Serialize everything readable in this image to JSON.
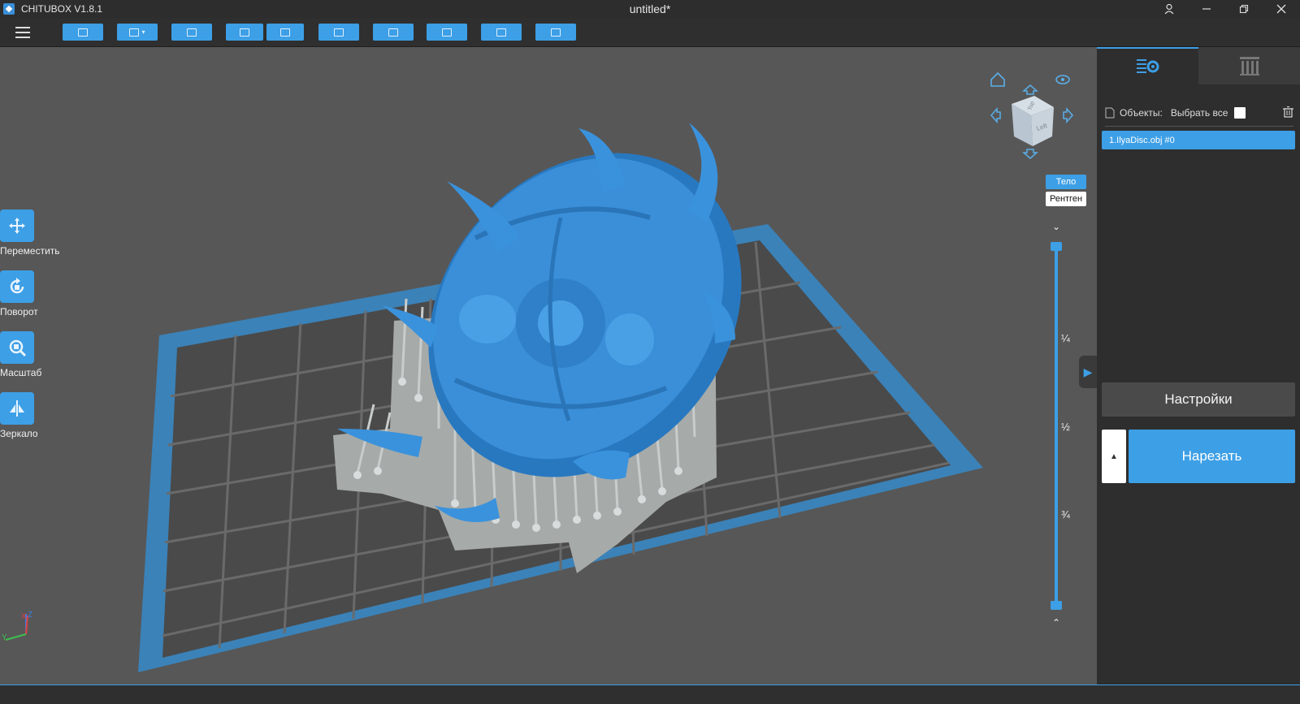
{
  "window": {
    "app_name": "CHITUBOX V1.8.1",
    "doc_title": "untitled*",
    "controls": [
      "user-icon",
      "minimize-icon",
      "restore-icon",
      "close-icon"
    ]
  },
  "toolbar": {
    "buttons": [
      "open-file-icon",
      "save-icon",
      "fit-view-icon",
      "undo-icon",
      "redo-icon",
      "layout-icon",
      "auto-arrange-icon",
      "support-icon",
      "hollow-icon",
      "print-icon"
    ]
  },
  "left_tools": [
    {
      "label": "Переместить",
      "icon": "move-icon"
    },
    {
      "label": "Поворот",
      "icon": "rotate-icon"
    },
    {
      "label": "Масштаб",
      "icon": "scale-icon"
    },
    {
      "label": "Зеркало",
      "icon": "mirror-icon"
    }
  ],
  "view": {
    "cube_face": "Left",
    "cube_top": "Top",
    "mode_body": "Тело",
    "mode_xray": "Рентген",
    "slider_marks": [
      "¼",
      "½",
      "¾"
    ],
    "axes": {
      "x": "X",
      "y": "Y",
      "z": "Z"
    }
  },
  "panel": {
    "objects_label": "Объекты:",
    "select_all_label": "Выбрать все",
    "object_item": "1.IlyaDisc.obj #0",
    "settings_label": "Настройки",
    "slice_label": "Нарезать",
    "colors": {
      "accent": "#3d9fe6",
      "panel": "#2e2e2e",
      "viewport": "#575757"
    }
  }
}
